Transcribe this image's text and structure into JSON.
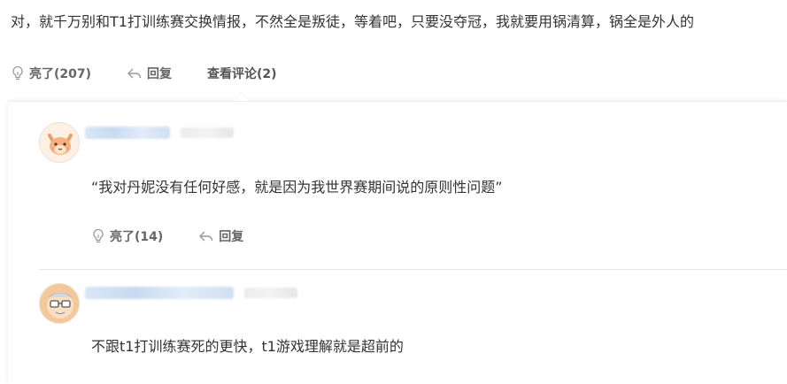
{
  "post": {
    "text": "对，就千万别和T1打训练赛交换情报，不然全是叛徒，等着吧，只要没夺冠，我就要用锅清算，锅全是外人的",
    "like_label": "亮了(207)",
    "reply_label": "回复",
    "view_comments_label": "查看评论(2)"
  },
  "comments": [
    {
      "text": "“我对丹妮没有任何好感，就是因为我世界赛期间说的原则性问题”",
      "like_label": "亮了(14)",
      "reply_label": "回复"
    },
    {
      "text": "不跟t1打训练赛死的更快，t1游戏理解就是超前的"
    }
  ],
  "colors": {
    "text": "#333333",
    "muted": "#666666",
    "divider": "#e8e8e8",
    "blurred_name": "#c8daf1"
  },
  "icons": [
    "lightbulb-icon",
    "reply-arrow-icon"
  ]
}
